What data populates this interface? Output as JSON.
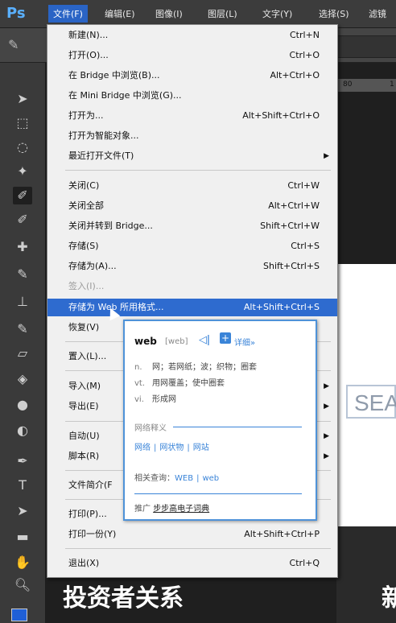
{
  "app": {
    "logo": "Ps"
  },
  "menubar": [
    {
      "label": "文件(F)",
      "active": true
    },
    {
      "label": "编辑(E)"
    },
    {
      "label": "图像(I)"
    },
    {
      "label": "图层(L)"
    },
    {
      "label": "文字(Y)"
    },
    {
      "label": "选择(S)"
    },
    {
      "label": "滤镜"
    }
  ],
  "file_menu": {
    "items": [
      {
        "label": "新建(N)...",
        "shortcut": "Ctrl+N"
      },
      {
        "label": "打开(O)...",
        "shortcut": "Ctrl+O"
      },
      {
        "label": "在 Bridge 中浏览(B)...",
        "shortcut": "Alt+Ctrl+O"
      },
      {
        "label": "在 Mini Bridge 中浏览(G)...",
        "shortcut": ""
      },
      {
        "label": "打开为...",
        "shortcut": "Alt+Shift+Ctrl+O"
      },
      {
        "label": "打开为智能对象...",
        "shortcut": ""
      },
      {
        "label": "最近打开文件(T)",
        "shortcut": "",
        "submenu": true
      },
      {
        "label": "关闭(C)",
        "shortcut": "Ctrl+W"
      },
      {
        "label": "关闭全部",
        "shortcut": "Alt+Ctrl+W"
      },
      {
        "label": "关闭并转到 Bridge...",
        "shortcut": "Shift+Ctrl+W"
      },
      {
        "label": "存储(S)",
        "shortcut": "Ctrl+S"
      },
      {
        "label": "存储为(A)...",
        "shortcut": "Shift+Ctrl+S"
      },
      {
        "label": "签入(I)...",
        "shortcut": "",
        "disabled": true
      },
      {
        "label": "存储为 Web 所用格式...",
        "shortcut": "Alt+Shift+Ctrl+S",
        "highlighted": true
      },
      {
        "label": "恢复(V)",
        "shortcut": ""
      },
      {
        "label": "置入(L)...",
        "shortcut": ""
      },
      {
        "label": "导入(M)",
        "shortcut": "",
        "submenu": true
      },
      {
        "label": "导出(E)",
        "shortcut": "",
        "submenu": true
      },
      {
        "label": "自动(U)",
        "shortcut": "",
        "submenu": true
      },
      {
        "label": "脚本(R)",
        "shortcut": "",
        "submenu": true
      },
      {
        "label": "文件简介(F",
        "shortcut": ""
      },
      {
        "label": "打印(P)...",
        "shortcut": ""
      },
      {
        "label": "打印一份(Y)",
        "shortcut": "Alt+Shift+Ctrl+P"
      },
      {
        "label": "退出(X)",
        "shortcut": "Ctrl+Q"
      }
    ]
  },
  "dictionary": {
    "word": "web",
    "phonetic": "[web]",
    "sound_icon": "speaker-icon",
    "detail_label": "详细»",
    "definitions": [
      {
        "pos": "n.",
        "text": "网；若网纸；波；织物；圈套"
      },
      {
        "pos": "vt.",
        "text": "用网覆盖；使中圈套"
      },
      {
        "pos": "vi.",
        "text": "形成网"
      }
    ],
    "section_title": "网络释义",
    "web_links": [
      "网络",
      "网状物",
      "网站"
    ],
    "related_label": "相关查询：",
    "related_links": [
      "WEB",
      "web"
    ],
    "ad_prefix": "推广",
    "ad_text": "步步高电子词典"
  },
  "ruler": {
    "ticks": [
      "80",
      "1"
    ]
  },
  "canvas": {
    "search_text": "SEA",
    "bottom_text": "投资者关系",
    "bottom_text2": "新"
  },
  "colors": {
    "accent": "#2e6bcf",
    "foreground": "#1f5fd6"
  }
}
